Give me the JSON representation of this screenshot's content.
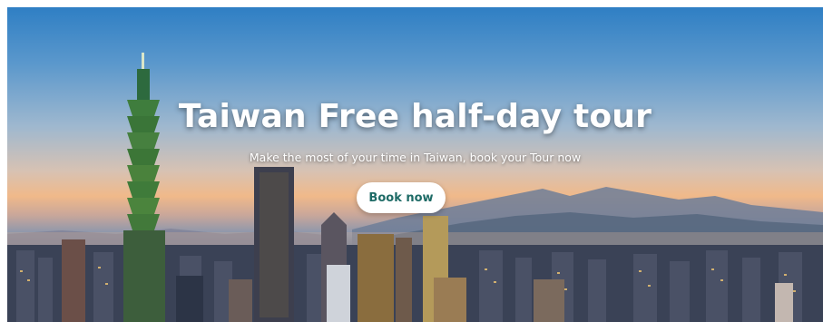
{
  "hero": {
    "title": "Taiwan Free half-day tour",
    "subtitle": "Make the most of your time in Taiwan, book your Tour now",
    "cta_label": "Book now",
    "cta_color": "#1e6b66",
    "background_image": "taipei-skyline-photo"
  }
}
